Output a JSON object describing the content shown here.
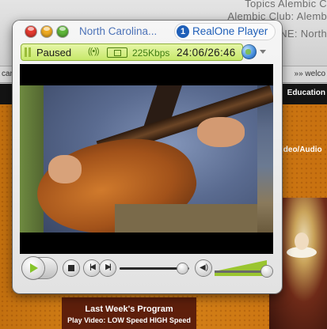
{
  "background_page": {
    "tab_text_top": "Topics   Alembic C",
    "window_title_text": "Alembic Club: Alemb",
    "partial_text": "DNE: North",
    "tab_left": "car",
    "tab_right": "»» welco",
    "nav_link": "Education",
    "section_label": "ideo/Audio",
    "program_title": "Last Week's Program",
    "program_links": "Play Video:  LOW Speed  HIGH Speed"
  },
  "player": {
    "window_title": "North Carolina...",
    "brand_logo": "1",
    "brand": "RealOne Player",
    "status": {
      "state": "Paused",
      "signal": "((•))",
      "bitrate": "225Kbps",
      "timecode": "24:06/26:46"
    },
    "seek_position": 0.9,
    "volume_level": 1.0,
    "icons": {
      "prev": "skip-back-icon",
      "next": "skip-forward-icon",
      "volume": "speaker-icon",
      "globe": "globe-icon"
    },
    "glyphs": {
      "prev": "|◀",
      "next": "▶|",
      "speaker": "◀)"
    },
    "accent_color": "#9ac52f"
  }
}
